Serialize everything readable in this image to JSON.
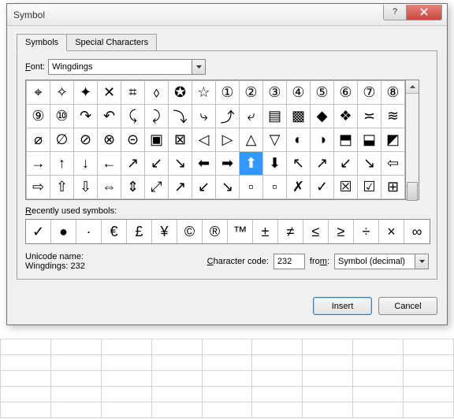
{
  "window": {
    "title": "Symbol",
    "help_tooltip": "?",
    "close_label": "Close"
  },
  "tabs": {
    "symbols": "Symbols",
    "special": "Special Characters"
  },
  "font": {
    "label": "Font:",
    "value": "Wingdings"
  },
  "grid": {
    "cols": 16,
    "rows": 5,
    "selected_index": 57,
    "cells": [
      "⌖",
      "✧",
      "✦",
      "✕",
      "⌗",
      "⬨",
      "✪",
      "☆",
      "①",
      "②",
      "③",
      "④",
      "⑤",
      "⑥",
      "⑦",
      "⑧",
      "⑨",
      "⑩",
      "↷",
      "↶",
      "⤹",
      "⤸",
      "⤵",
      "⤷",
      "⤴",
      "⤶",
      "▤",
      "▩",
      "◆",
      "❖",
      "≍",
      "≋",
      "⌀",
      "∅",
      "⊘",
      "⊗",
      "⊝",
      "▣",
      "⊠",
      "◁",
      "▷",
      "△",
      "▽",
      "◐",
      "◑",
      "⬒",
      "⬓",
      "◩",
      "→",
      "↑",
      "↓",
      "←",
      "↗",
      "↙",
      "↘",
      "⬅",
      "➡",
      "⬆",
      "⬇",
      "↖",
      "↗",
      "↙",
      "↘",
      "⇦",
      "⇨",
      "⇧",
      "⇩",
      "⇔",
      "⇕",
      "⤢",
      "↗",
      "↙",
      "↘",
      "▫",
      "▫",
      "✗",
      "✓",
      "☒",
      "☑",
      "⊞"
    ]
  },
  "recent": {
    "label": "Recently used symbols:",
    "cells": [
      "✓",
      "●",
      "·",
      "€",
      "£",
      "¥",
      "©",
      "®",
      "™",
      "±",
      "≠",
      "≤",
      "≥",
      "÷",
      "×",
      "∞"
    ]
  },
  "info": {
    "unicode_name_label": "Unicode name:",
    "name_value": "Wingdings: 232",
    "char_code_label": "Character code:",
    "char_code_value": "232",
    "from_label": "from:",
    "from_value": "Symbol (decimal)"
  },
  "buttons": {
    "insert": "Insert",
    "cancel": "Cancel"
  }
}
